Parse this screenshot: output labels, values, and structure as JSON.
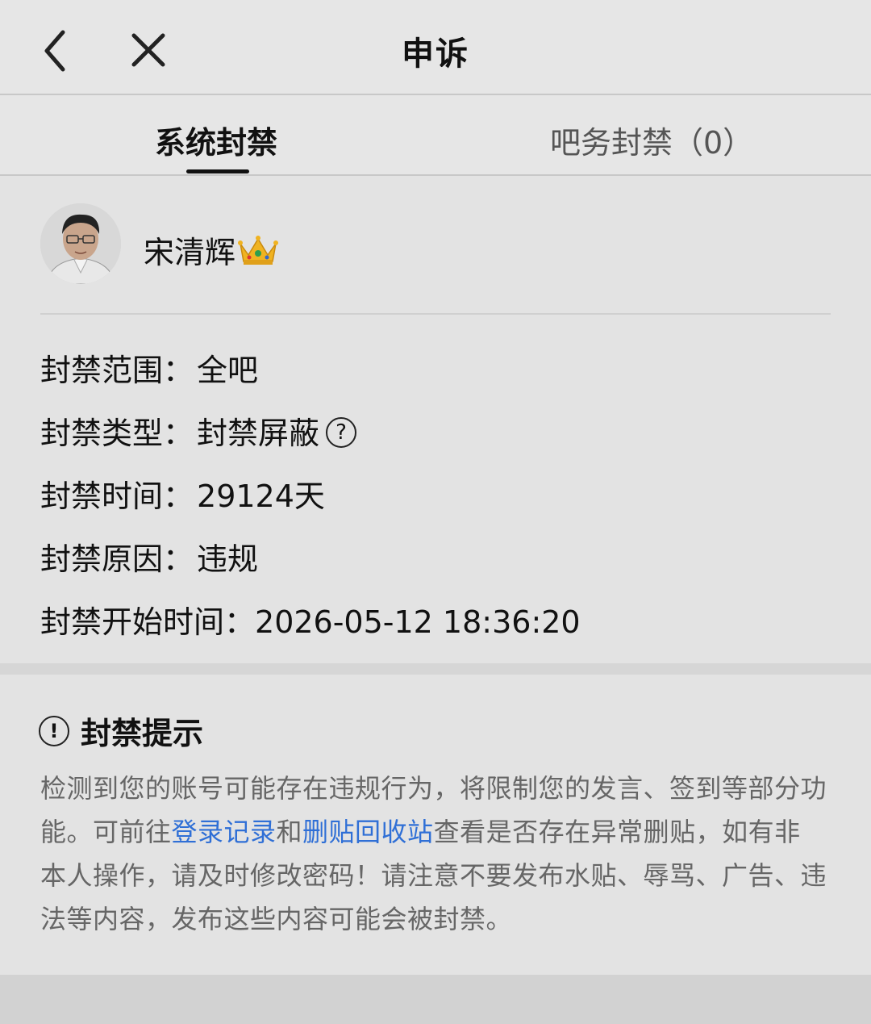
{
  "header": {
    "title": "申诉",
    "back_icon": "chevron-left-icon",
    "close_icon": "close-icon"
  },
  "tabs": [
    {
      "label": "系统封禁",
      "active": true
    },
    {
      "label": "吧务封禁（0）",
      "active": false
    }
  ],
  "user": {
    "name": "宋清辉",
    "badge_icon": "crown-icon"
  },
  "ban_info": {
    "scope_label": "封禁范围：",
    "scope_value": "全吧",
    "type_label": "封禁类型：",
    "type_value": "封禁屏蔽",
    "type_help_icon": "help-icon",
    "duration_label": "封禁时间：",
    "duration_value": "29124天",
    "reason_label": "封禁原因：",
    "reason_value": "违规",
    "start_label": "封禁开始时间：",
    "start_value": "2026-05-12 18:36:20"
  },
  "notice": {
    "title": "封禁提示",
    "icon": "warning-icon",
    "text_part1": "检测到您的账号可能存在违规行为，将限制您的发言、签到等部分功能。可前往",
    "link1": "登录记录",
    "text_part2": "和",
    "link2": "删贴回收站",
    "text_part3": "查看是否存在异常删贴，如有非本人操作，请及时修改密码！请注意不要发布水贴、辱骂、广告、违法等内容，发布这些内容可能会被封禁。"
  },
  "colors": {
    "link": "#2f6fd6",
    "background": "#e3e3e3",
    "text": "#1a1a1a",
    "muted": "#666666"
  }
}
